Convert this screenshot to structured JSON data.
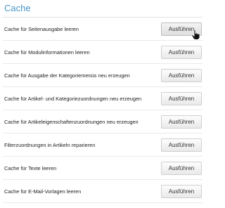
{
  "panel": {
    "title": "Cache"
  },
  "rows": [
    {
      "label": "Cache für Seitenausgabe leeren",
      "button": "Ausführen"
    },
    {
      "label": "Cache für Modulinformationen leeren",
      "button": "Ausführen"
    },
    {
      "label": "Cache für Ausgabe der Kategoriemenüs neu erzeugen",
      "button": "Ausführen"
    },
    {
      "label": "Cache für Artikel- und Kategoriezuordnungen neu erzeugen",
      "button": "Ausführen"
    },
    {
      "label": "Cache für Artikeleigenschaftenzuordnungen neu erzeugen",
      "button": "Ausführen"
    },
    {
      "label": "Filterzuordnungen in Artikeln reparieren",
      "button": "Ausführen"
    },
    {
      "label": "Cache für Texte leeren",
      "button": "Ausführen"
    },
    {
      "label": "Cache für E-Mail-Vorlagen leeren",
      "button": "Ausführen"
    }
  ],
  "colors": {
    "title": "#4a97c9",
    "text": "#222222",
    "divider": "#e9e9e9"
  },
  "icons": {
    "cursor": "hand-pointer-icon"
  }
}
